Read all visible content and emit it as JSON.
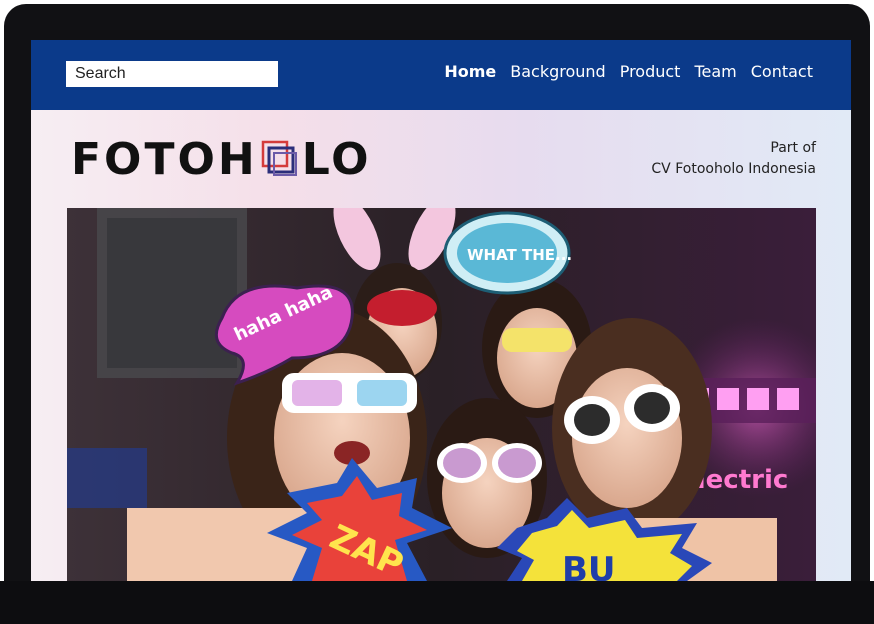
{
  "search": {
    "placeholder": "Search"
  },
  "nav": {
    "items": [
      {
        "label": "Home",
        "active": true
      },
      {
        "label": "Background"
      },
      {
        "label": "Product"
      },
      {
        "label": "Team"
      },
      {
        "label": "Contact"
      }
    ]
  },
  "brand": {
    "logo_left": "FOTOH",
    "logo_right": "LO",
    "affiliation_line1": "Part of",
    "affiliation_line2": "CV Fotooholo Indonesia"
  },
  "hero_photo": {
    "props": {
      "speech_bubble_1": "haha haha",
      "speech_bubble_2": "WHAT THE...",
      "burst_1": "ZAP",
      "burst_2": "BU",
      "neon_sign": "Electric"
    }
  },
  "colors": {
    "nav_bg": "#0b3a8a",
    "device_frame": "#111114",
    "logo_mark_red": "#d43b3b",
    "logo_mark_blue": "#2b2e7a"
  }
}
